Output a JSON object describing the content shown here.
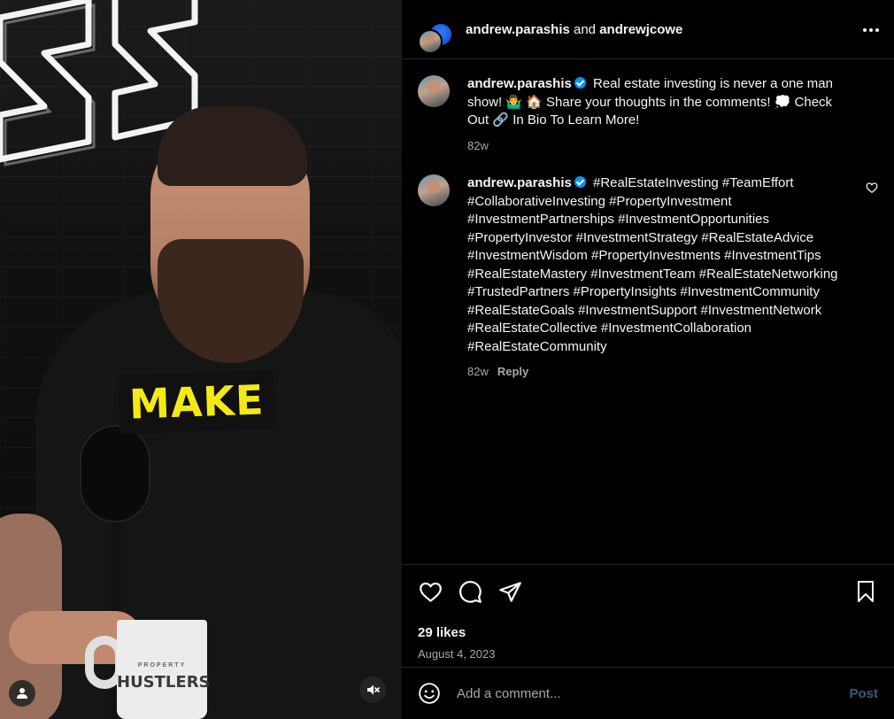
{
  "header": {
    "user1": "andrew.parashis",
    "joiner": " and ",
    "user2": "andrewjcowe",
    "more_icon": "more-horizontal-icon"
  },
  "media": {
    "caption_text": "MAKE",
    "mug_brand_small": "PROPERTY",
    "mug_brand": "HUSTLERS",
    "mute_icon": "speaker-muted-icon",
    "tags_icon": "user-tag-icon"
  },
  "comments": [
    {
      "username": "andrew.parashis",
      "text": "Real estate investing is never a one man show! 🤷‍♂️ 🏠 Share your thoughts in the comments! 💭 Check Out 🔗 In Bio To Learn More!",
      "time": "82w"
    },
    {
      "username": "andrew.parashis",
      "text": "#RealEstateInvesting #TeamEffort #CollaborativeInvesting #PropertyInvestment #InvestmentPartnerships #InvestmentOpportunities #PropertyInvestor #InvestmentStrategy #RealEstateAdvice #InvestmentWisdom #PropertyInvestments #InvestmentTips #RealEstateMastery #InvestmentTeam #RealEstateNetworking #TrustedPartners #PropertyInsights #InvestmentCommunity #RealEstateGoals #InvestmentSupport #InvestmentNetwork #RealEstateCollective #InvestmentCollaboration #RealEstateCommunity",
      "time": "82w",
      "reply_label": "Reply"
    }
  ],
  "actions": {
    "likes": "29 likes",
    "date": "August 4, 2023"
  },
  "add_comment": {
    "placeholder": "Add a comment...",
    "post_label": "Post"
  },
  "colors": {
    "background": "#000000",
    "text": "#f5f5f5",
    "secondary_text": "#a8a8a8",
    "verified": "#0095f6",
    "post_disabled": "#3a5a83",
    "caption_yellow": "#f3ea15"
  }
}
